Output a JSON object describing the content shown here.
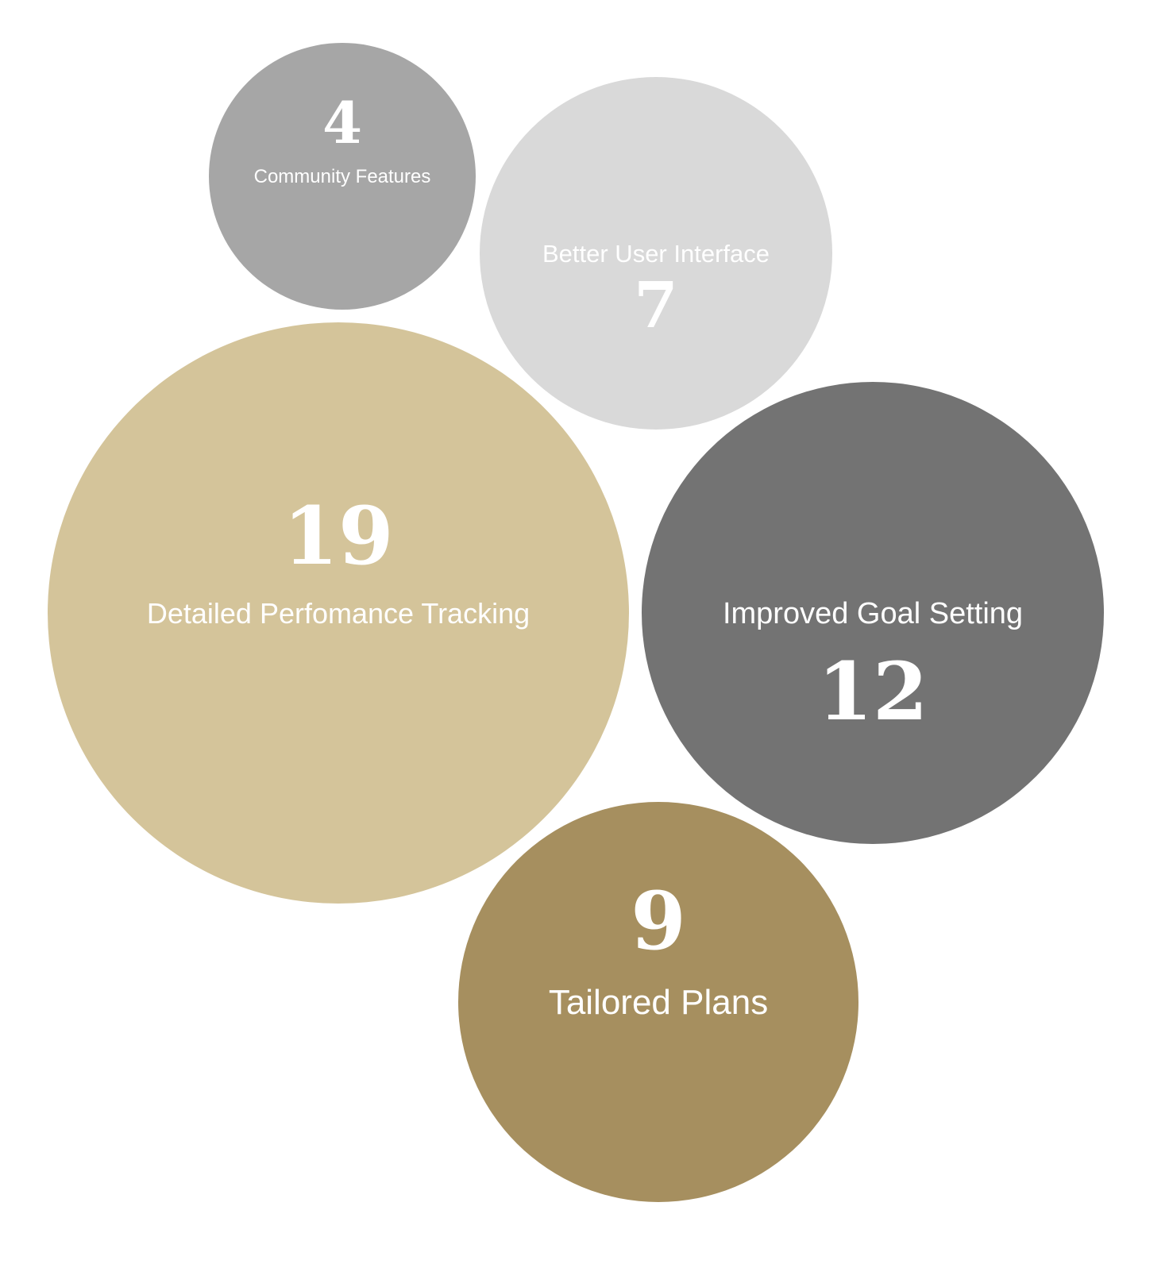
{
  "chart_data": {
    "type": "bubble",
    "title": "",
    "bubbles": [
      {
        "label": "Community Features",
        "value": 4,
        "color": "#a6a6a6"
      },
      {
        "label": "Better User Interface",
        "value": 7,
        "color": "#d9d9d9"
      },
      {
        "label": "Detailed Perfomance Tracking",
        "value": 19,
        "color": "#d4c49a"
      },
      {
        "label": "Improved Goal Setting",
        "value": 12,
        "color": "#737373"
      },
      {
        "label": "Tailored Plans",
        "value": 9,
        "color": "#a68f5f"
      }
    ]
  }
}
